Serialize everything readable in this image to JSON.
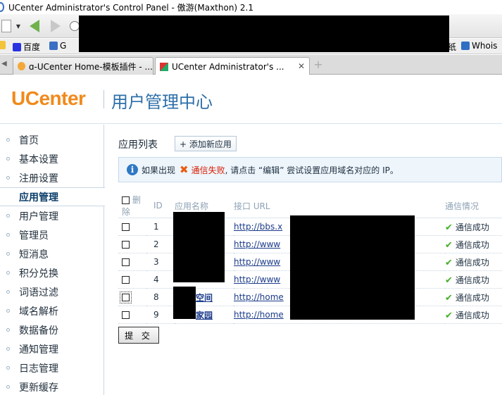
{
  "window": {
    "title": "UCenter Administrator's Control Panel - 傲游(Maxthon) 2.1"
  },
  "favorites": [
    {
      "label": "百度",
      "icon": "baidu-paw-icon",
      "color": "#2932e1"
    },
    {
      "label": "G",
      "icon": "google-icon",
      "color": "#3a6fc4"
    },
    {
      "label": "纸",
      "icon": "bookmark-icon",
      "color": "#888888"
    },
    {
      "label": "Whois",
      "icon": "whois-icon",
      "color": "#2f6fc4"
    }
  ],
  "tabs": [
    {
      "label": "ɑ-UCenter Home-模板插件 - ...",
      "active": false
    },
    {
      "label": "UCenter Administrator's ...",
      "active": true,
      "close": "✕"
    }
  ],
  "header": {
    "logo": "UCenter",
    "subtitle": "用户管理中心",
    "logo_color": "#f08a1c",
    "subtitle_color": "#2d6fa8"
  },
  "sidebar": {
    "items": [
      {
        "label": "首页",
        "active": false
      },
      {
        "label": "基本设置",
        "active": false
      },
      {
        "label": "注册设置",
        "active": false
      },
      {
        "label": "应用管理",
        "active": true
      },
      {
        "label": "用户管理",
        "active": false
      },
      {
        "label": "管理员",
        "active": false
      },
      {
        "label": "短消息",
        "active": false
      },
      {
        "label": "积分兑换",
        "active": false
      },
      {
        "label": "词语过滤",
        "active": false
      },
      {
        "label": "域名解析",
        "active": false
      },
      {
        "label": "数据备份",
        "active": false
      },
      {
        "label": "通知管理",
        "active": false
      },
      {
        "label": "日志管理",
        "active": false
      },
      {
        "label": "更新缓存",
        "active": false
      }
    ]
  },
  "main": {
    "section_title": "应用列表",
    "add_button": "+ 添加新应用",
    "notice": {
      "prefix": "如果出现",
      "fail_text": "通信失败",
      "suffix": ", 请点击 “编辑” 尝试设置应用域名对应的 IP。"
    },
    "table": {
      "headers": {
        "delete": "删除",
        "id": "ID",
        "name": "应用名称",
        "url": "接口 URL",
        "status": "通信情况"
      },
      "rows": [
        {
          "id": "1",
          "name": "",
          "url": "http://bbs.x",
          "status": "通信成功"
        },
        {
          "id": "2",
          "name": "",
          "url": "http://www",
          "status": "通信成功"
        },
        {
          "id": "3",
          "name": "",
          "url": "http://www",
          "status": "通信成功"
        },
        {
          "id": "4",
          "name": "",
          "url": "http://www",
          "status": "通信成功"
        },
        {
          "id": "8",
          "name": "空间",
          "url": "http://home",
          "status": "通信成功"
        },
        {
          "id": "9",
          "name": "家园",
          "url": "http://home",
          "status": "通信成功"
        }
      ]
    },
    "submit_label": "提 交",
    "status_color": "#1f8b1f",
    "fail_color": "#d81e06"
  }
}
